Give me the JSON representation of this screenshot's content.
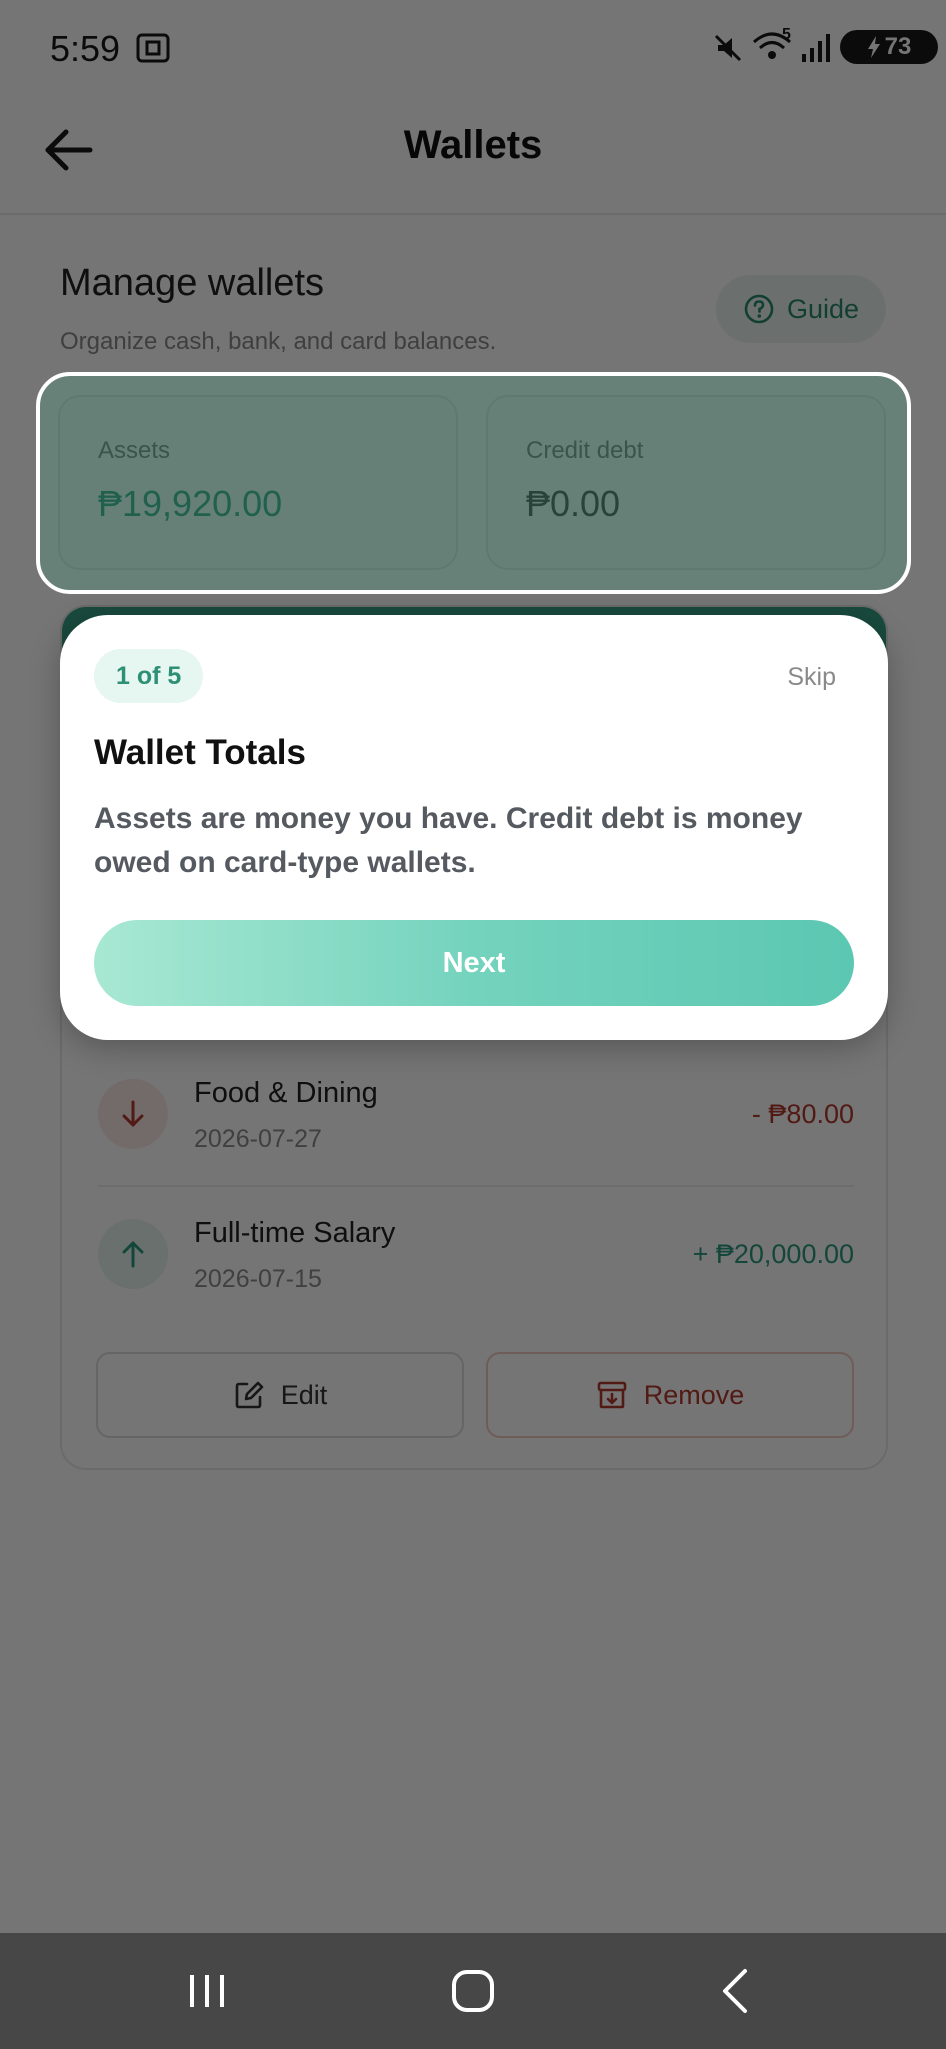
{
  "status_bar": {
    "time": "5:59",
    "wifi_badge": "5",
    "battery": "73"
  },
  "app_bar": {
    "title": "Wallets"
  },
  "header": {
    "title": "Manage wallets",
    "subtitle": "Organize cash, bank, and card balances.",
    "guide_label": "Guide"
  },
  "totals": {
    "assets_label": "Assets",
    "assets_value": "₱19,920.00",
    "debt_label": "Credit debt",
    "debt_value": "₱0.00"
  },
  "transactions": [
    {
      "name": "Food & Dining",
      "date": "2026-07-27",
      "amount": "- ₱80.00",
      "direction": "down"
    },
    {
      "name": "Full-time Salary",
      "date": "2026-07-15",
      "amount": "+ ₱20,000.00",
      "direction": "up"
    }
  ],
  "actions": {
    "edit_label": "Edit",
    "remove_label": "Remove"
  },
  "tour": {
    "step": "1 of 5",
    "skip_label": "Skip",
    "title": "Wallet Totals",
    "body": "Assets are money you have. Credit debt is money owed on card-type wallets.",
    "next_label": "Next"
  },
  "colors": {
    "accent": "#2d9c7e",
    "negative": "#b43a2e",
    "scrim": "#000000"
  }
}
